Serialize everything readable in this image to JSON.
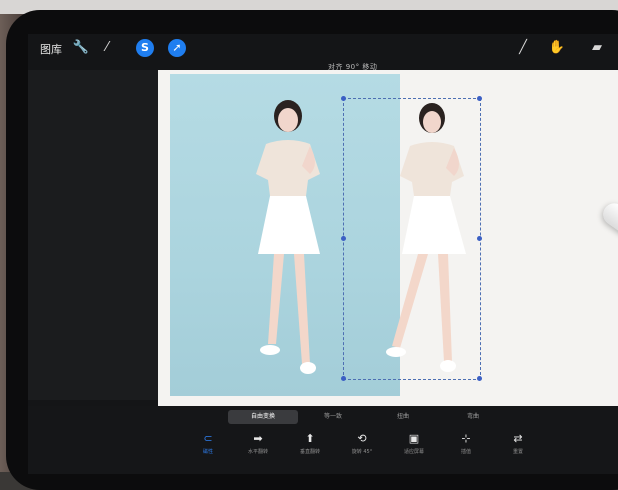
{
  "toolbar": {
    "gallery_label": "图库",
    "icons": {
      "adjust": "wrench-icon",
      "adjustments": "magic-wand-icon",
      "selection": "selection-icon",
      "transform": "arrow-cursor-icon",
      "brush": "brush-icon",
      "smudge": "smudge-icon",
      "eraser": "eraser-icon"
    }
  },
  "snap_label": "对齐 90° 移动",
  "transform_tabs": [
    {
      "label": "自由变换",
      "active": true
    },
    {
      "label": "等一致",
      "active": false
    },
    {
      "label": "扭曲",
      "active": false
    },
    {
      "label": "弯曲",
      "active": false
    }
  ],
  "transform_tools": [
    {
      "label": "磁性",
      "icon": "magnet-icon",
      "active": true
    },
    {
      "label": "水平翻转",
      "icon": "flip-horizontal-icon",
      "active": false
    },
    {
      "label": "垂直翻转",
      "icon": "flip-vertical-icon",
      "active": false
    },
    {
      "label": "旋转 45°",
      "icon": "rotate-icon",
      "active": false
    },
    {
      "label": "适应屏幕",
      "icon": "fit-screen-icon",
      "active": false
    },
    {
      "label": "插值",
      "icon": "interpolation-icon",
      "active": false
    },
    {
      "label": "重置",
      "icon": "reset-icon",
      "active": false
    }
  ],
  "colors": {
    "accent": "#1f7ef0",
    "photo_background": "#aed5df",
    "canvas": "#f4f3f1",
    "selection": "#3b5fc4"
  }
}
